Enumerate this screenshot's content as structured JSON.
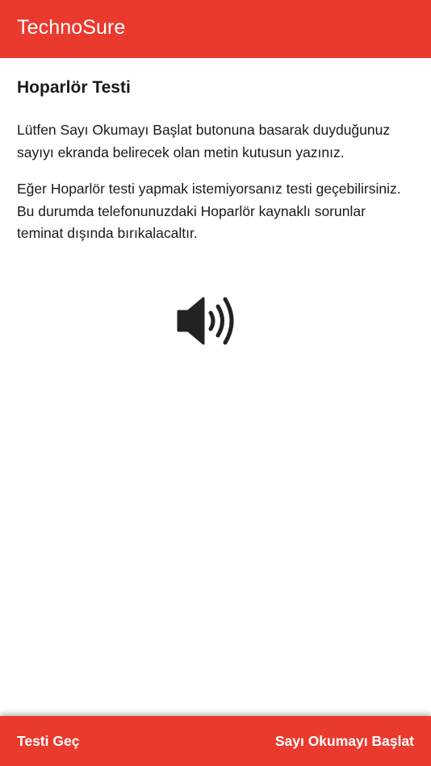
{
  "app_bar": {
    "title": "TechnoSure"
  },
  "content": {
    "heading": "Hoparlör Testi",
    "paragraph_1": "Lütfen Sayı Okumayı Başlat butonuna basarak duyduğunuz sayıyı ekranda belirecek olan metin kutusun yazınız.",
    "paragraph_2": "Eğer Hoparlör testi yapmak istemiyorsanız testi geçebilirsiniz. Bu durumda telefonunuzdaki Hoparlör kaynaklı sorunlar teminat dışında bırıkalacaltır.",
    "icon": "speaker-volume-icon"
  },
  "bottom_bar": {
    "skip_label": "Testi Geç",
    "start_label": "Sayı Okumayı Başlat"
  },
  "colors": {
    "accent": "#EA3A2E",
    "text": "#1a1a1a",
    "icon": "#222222",
    "background": "#ffffff"
  }
}
